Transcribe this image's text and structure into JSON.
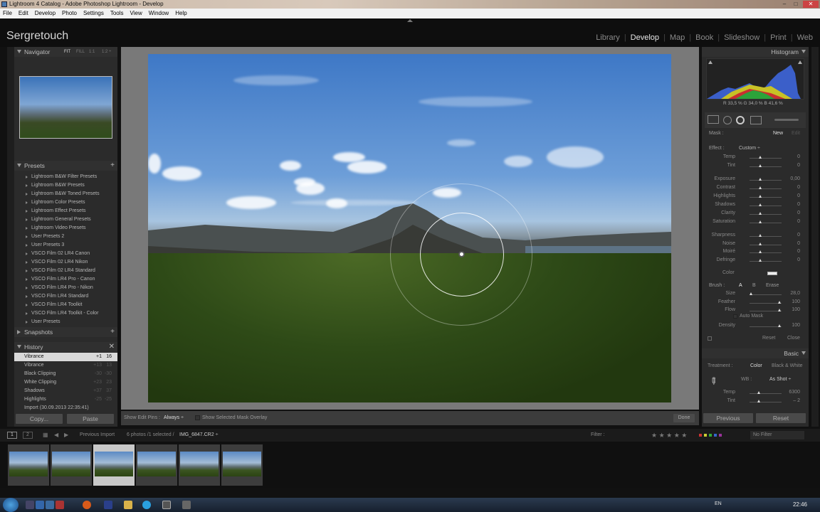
{
  "window": {
    "title": "Lightroom 4 Catalog - Adobe Photoshop Lightroom - Develop",
    "controls": [
      "–",
      "□",
      "✕"
    ]
  },
  "menu": [
    "File",
    "Edit",
    "Develop",
    "Photo",
    "Settings",
    "Tools",
    "View",
    "Window",
    "Help"
  ],
  "brand": "Sergretouch",
  "modules": [
    {
      "label": "Library"
    },
    {
      "label": "Develop",
      "active": true
    },
    {
      "label": "Map"
    },
    {
      "label": "Book"
    },
    {
      "label": "Slideshow"
    },
    {
      "label": "Print"
    },
    {
      "label": "Web"
    }
  ],
  "navigator": {
    "title": "Navigator",
    "zoom": [
      "FIT",
      "FILL",
      "1:1",
      "1:2 ÷"
    ]
  },
  "presets": {
    "title": "Presets",
    "items": [
      "Lightroom B&W Filter Presets",
      "Lightroom B&W Presets",
      "Lightroom B&W Toned Presets",
      "Lightroom Color Presets",
      "Lightroom Effect Presets",
      "Lightroom General Presets",
      "Lightroom Video Presets",
      "User Presets 2",
      "User Presets 3",
      "VSCO Film 02 LR4 Canon",
      "VSCO Film 02 LR4 Nikon",
      "VSCO Film 02 LR4 Standard",
      "VSCO Film LR4 Pro - Canon",
      "VSCO Film LR4 Pro - Nikon",
      "VSCO Film LR4 Standard",
      "VSCO Film LR4 Toolkit",
      "VSCO Film LR4 Toolkit - Color",
      "User Presets"
    ]
  },
  "snapshots": {
    "title": "Snapshots"
  },
  "history": {
    "title": "History",
    "items": [
      {
        "label": "Vibrance",
        "v1": "+1",
        "v2": "16",
        "selected": true
      },
      {
        "label": "Vibrance",
        "v1": "+13",
        "v2": "13"
      },
      {
        "label": "Black Clipping",
        "v1": "-30",
        "v2": "-30"
      },
      {
        "label": "White Clipping",
        "v1": "+23",
        "v2": "23"
      },
      {
        "label": "Shadows",
        "v1": "+37",
        "v2": "37"
      },
      {
        "label": "Highlights",
        "v1": "-25",
        "v2": "-25"
      },
      {
        "label": "Import (30.09.2013 22:35:41)",
        "v1": "",
        "v2": ""
      }
    ]
  },
  "leftbuttons": {
    "copy": "Copy...",
    "paste": "Paste"
  },
  "toolbar": {
    "show_edit_pins": "Show Edit Pins :",
    "pins_value": "Always ÷",
    "mask_overlay": "Show Selected Mask Overlay",
    "done": "Done"
  },
  "histogram": {
    "title": "Histogram",
    "readout": "R  33,5  %   G  34,0  %   B  41,6  %"
  },
  "mask": {
    "label": "Mask :",
    "new": "New",
    "edit": "Edit"
  },
  "effect": {
    "label": "Effect :",
    "value": "Custom ÷",
    "rows": [
      {
        "label": "Temp",
        "val": "0"
      },
      {
        "label": "Tint",
        "val": "0"
      },
      {
        "label": "Exposure",
        "val": "0,00"
      },
      {
        "label": "Contrast",
        "val": "0"
      },
      {
        "label": "Highlights",
        "val": "0"
      },
      {
        "label": "Shadows",
        "val": "0"
      },
      {
        "label": "Clarity",
        "val": "0"
      },
      {
        "label": "Saturation",
        "val": "0"
      },
      {
        "label": "Sharpness",
        "val": "0"
      },
      {
        "label": "Noise",
        "val": "0"
      },
      {
        "label": "Moiré",
        "val": "0"
      },
      {
        "label": "Defringe",
        "val": "0"
      }
    ],
    "color_label": "Color"
  },
  "brush": {
    "label": "Brush :",
    "a": "A",
    "b": "B",
    "erase": "Erase",
    "rows": [
      {
        "label": "Size",
        "val": "28,0"
      },
      {
        "label": "Feather",
        "val": "100"
      },
      {
        "label": "Flow",
        "val": "100"
      }
    ],
    "auto_mask": "Auto Mask",
    "density": {
      "label": "Density",
      "val": "100"
    },
    "reset": "Reset",
    "close": "Close"
  },
  "basic": {
    "title": "Basic",
    "treatment": "Treatment :",
    "color": "Color",
    "bw": "Black & White",
    "wb_label": "WB :",
    "wb_value": "As Shot ÷",
    "rows": [
      {
        "label": "Temp",
        "val": "6300"
      },
      {
        "label": "Tint",
        "val": "– 2"
      }
    ]
  },
  "rightbuttons": {
    "previous": "Previous",
    "reset": "Reset"
  },
  "filmbar": {
    "source": "Previous Import",
    "count": "6 photos /1 selected /",
    "file": "IMG_6847.CR2 ÷",
    "filter": "Filter :",
    "nofilter": "No Filter"
  },
  "stars": "★ ★ ★ ★ ★",
  "clock": "22:46",
  "tray_lang": "EN"
}
